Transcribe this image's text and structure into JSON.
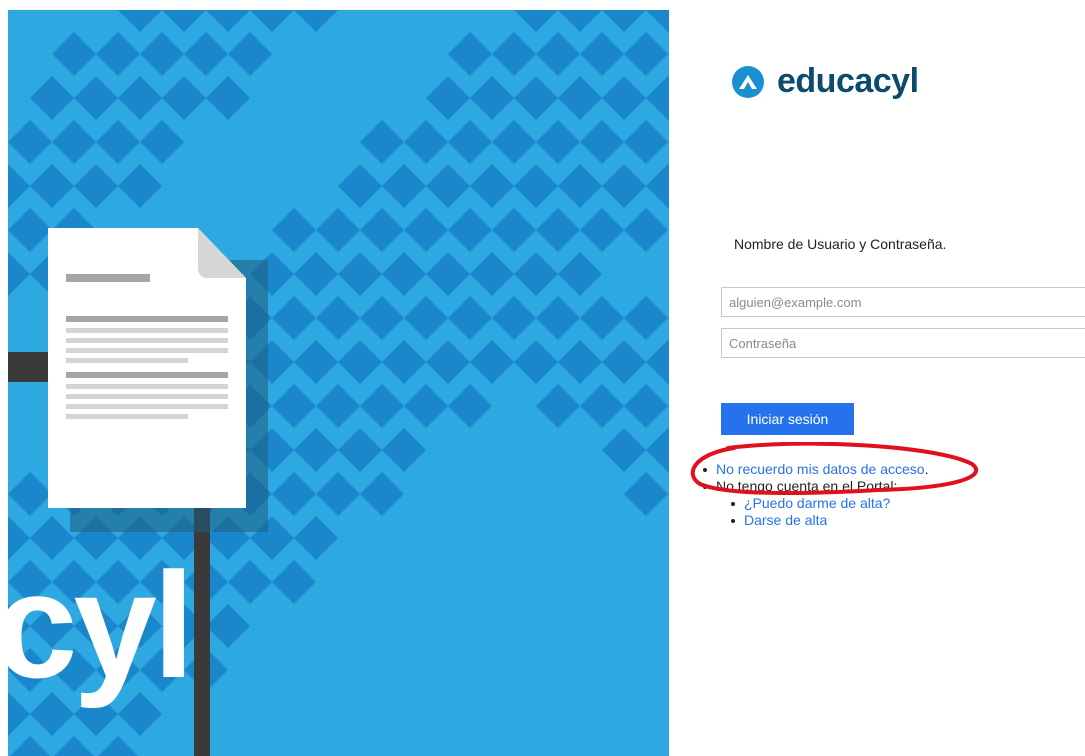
{
  "brand": {
    "name": "educacyl",
    "hero_text": "cyl",
    "colors": {
      "hero": "#2ea8e0",
      "accent": "#2672ec",
      "brand_text": "#0c4a6e",
      "annotation": "#e0101e"
    }
  },
  "form": {
    "prompt": "Nombre de Usuario y Contraseña.",
    "username_placeholder": "alguien@example.com",
    "password_placeholder": "Contraseña",
    "submit_label": "Iniciar sesión"
  },
  "links": {
    "forgot": "No recuerdo mis datos de acceso",
    "forgot_suffix": ".",
    "no_account": "No tengo cuenta en el Portal:",
    "can_register": "¿Puedo darme de alta?",
    "register": "Darse de alta"
  },
  "annotation": {
    "type": "hand-drawn ellipse",
    "target": "forgot-link"
  }
}
